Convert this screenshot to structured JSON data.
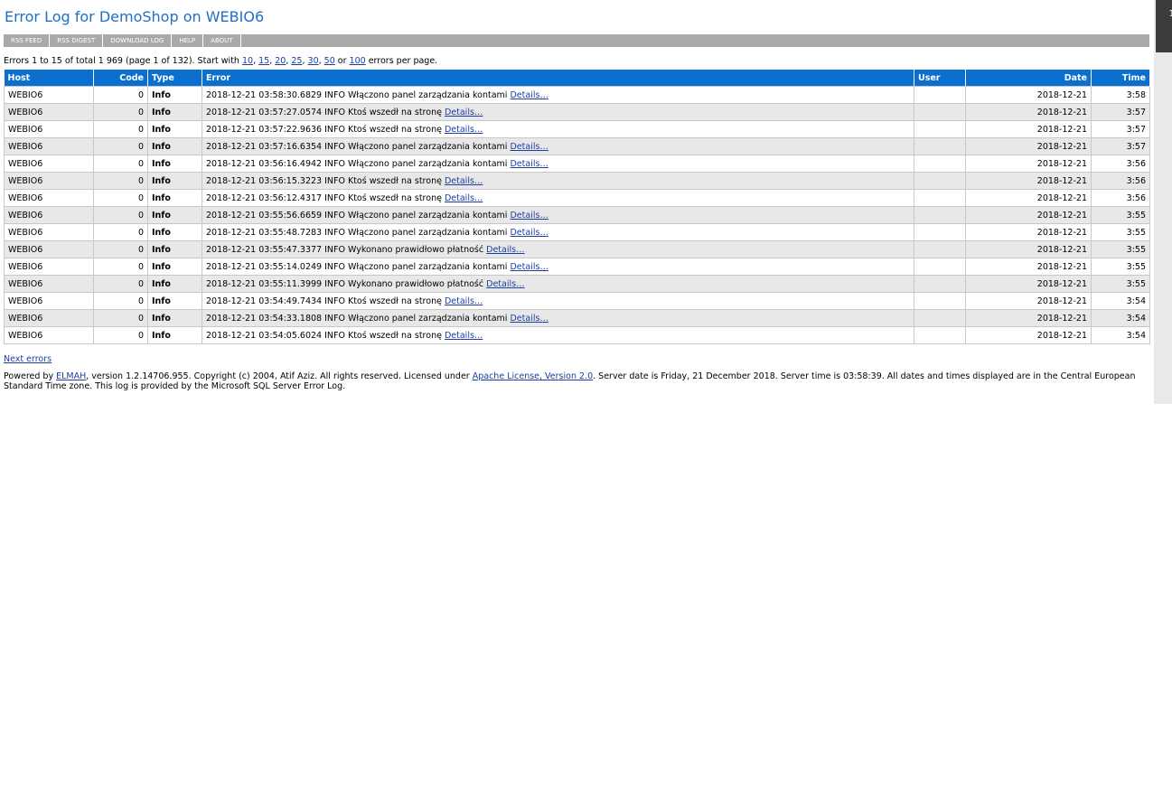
{
  "title": "Error Log for DemoShop on WEBIO6",
  "speedbar": [
    {
      "label": "RSS FEED",
      "name": "rss-feed-link"
    },
    {
      "label": "RSS DIGEST",
      "name": "rss-digest-link"
    },
    {
      "label": "DOWNLOAD LOG",
      "name": "download-log-link"
    },
    {
      "label": "HELP",
      "name": "help-link"
    },
    {
      "label": "ABOUT",
      "name": "about-link"
    }
  ],
  "summary": {
    "prefix": "Errors 1 to 15 of total 1 969 (page 1 of 132). Start with ",
    "sizes": [
      "10",
      "15",
      "20",
      "25",
      "30",
      "50",
      "100"
    ],
    "suffix": " errors per page."
  },
  "table": {
    "columns": [
      "Host",
      "Code",
      "Type",
      "Error",
      "User",
      "Date",
      "Time"
    ],
    "details_label": "Details…",
    "rows": [
      {
        "host": "WEBIO6",
        "code": "0",
        "type": "Info",
        "error": "2018-12-21 03:58:30.6829 INFO Włączono panel zarządzania kontami",
        "user": "",
        "date": "2018-12-21",
        "time": "3:58"
      },
      {
        "host": "WEBIO6",
        "code": "0",
        "type": "Info",
        "error": "2018-12-21 03:57:27.0574 INFO Ktoś wszedł na stronę",
        "user": "",
        "date": "2018-12-21",
        "time": "3:57"
      },
      {
        "host": "WEBIO6",
        "code": "0",
        "type": "Info",
        "error": "2018-12-21 03:57:22.9636 INFO Ktoś wszedł na stronę",
        "user": "",
        "date": "2018-12-21",
        "time": "3:57"
      },
      {
        "host": "WEBIO6",
        "code": "0",
        "type": "Info",
        "error": "2018-12-21 03:57:16.6354 INFO Włączono panel zarządzania kontami",
        "user": "",
        "date": "2018-12-21",
        "time": "3:57"
      },
      {
        "host": "WEBIO6",
        "code": "0",
        "type": "Info",
        "error": "2018-12-21 03:56:16.4942 INFO Włączono panel zarządzania kontami",
        "user": "",
        "date": "2018-12-21",
        "time": "3:56"
      },
      {
        "host": "WEBIO6",
        "code": "0",
        "type": "Info",
        "error": "2018-12-21 03:56:15.3223 INFO Ktoś wszedł na stronę",
        "user": "",
        "date": "2018-12-21",
        "time": "3:56"
      },
      {
        "host": "WEBIO6",
        "code": "0",
        "type": "Info",
        "error": "2018-12-21 03:56:12.4317 INFO Ktoś wszedł na stronę",
        "user": "",
        "date": "2018-12-21",
        "time": "3:56"
      },
      {
        "host": "WEBIO6",
        "code": "0",
        "type": "Info",
        "error": "2018-12-21 03:55:56.6659 INFO Włączono panel zarządzania kontami",
        "user": "",
        "date": "2018-12-21",
        "time": "3:55"
      },
      {
        "host": "WEBIO6",
        "code": "0",
        "type": "Info",
        "error": "2018-12-21 03:55:48.7283 INFO Włączono panel zarządzania kontami",
        "user": "",
        "date": "2018-12-21",
        "time": "3:55"
      },
      {
        "host": "WEBIO6",
        "code": "0",
        "type": "Info",
        "error": "2018-12-21 03:55:47.3377 INFO Wykonano prawidłowo płatność",
        "user": "",
        "date": "2018-12-21",
        "time": "3:55"
      },
      {
        "host": "WEBIO6",
        "code": "0",
        "type": "Info",
        "error": "2018-12-21 03:55:14.0249 INFO Włączono panel zarządzania kontami",
        "user": "",
        "date": "2018-12-21",
        "time": "3:55"
      },
      {
        "host": "WEBIO6",
        "code": "0",
        "type": "Info",
        "error": "2018-12-21 03:55:11.3999 INFO Wykonano prawidłowo płatność",
        "user": "",
        "date": "2018-12-21",
        "time": "3:55"
      },
      {
        "host": "WEBIO6",
        "code": "0",
        "type": "Info",
        "error": "2018-12-21 03:54:49.7434 INFO Ktoś wszedł na stronę",
        "user": "",
        "date": "2018-12-21",
        "time": "3:54"
      },
      {
        "host": "WEBIO6",
        "code": "0",
        "type": "Info",
        "error": "2018-12-21 03:54:33.1808 INFO Włączono panel zarządzania kontami",
        "user": "",
        "date": "2018-12-21",
        "time": "3:54"
      },
      {
        "host": "WEBIO6",
        "code": "0",
        "type": "Info",
        "error": "2018-12-21 03:54:05.6024 INFO Ktoś wszedł na stronę",
        "user": "",
        "date": "2018-12-21",
        "time": "3:54"
      }
    ]
  },
  "next_label": "Next errors",
  "footer": {
    "prefix": "Powered by ",
    "elmah_label": "ELMAH",
    "middle": ", version 1.2.14706.955. Copyright (c) 2004, Atif Aziz. All rights reserved. Licensed under ",
    "license_label": "Apache License, Version 2.0",
    "suffix": ". Server date is Friday, 21 December 2018. Server time is 03:58:39. All dates and times displayed are in the Central European Standard Time zone. This log is provided by the Microsoft SQL Server Error Log."
  },
  "scrollbar_glyph": "1"
}
